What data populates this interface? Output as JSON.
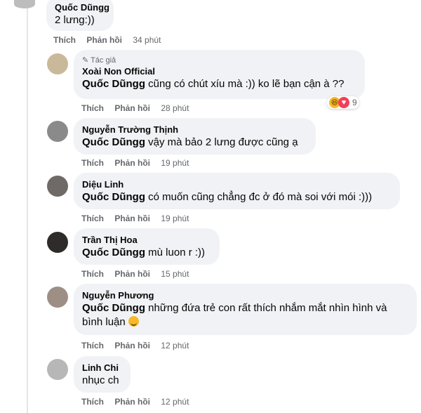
{
  "actions": {
    "like": "Thích",
    "reply": "Phản hồi"
  },
  "author_badge": "Tác giả",
  "top": {
    "name": "Quốc Dũngg",
    "text": "2 lưng:))",
    "time": "34 phút"
  },
  "comments": [
    {
      "name": "Xoài Non Official",
      "mention": "Quốc Dũngg",
      "text": " cũng có chút xíu mà :)) ko lẽ bạn cận à ??",
      "time": "28 phút",
      "reaction_count": "9",
      "reactions": [
        "haha",
        "love"
      ]
    },
    {
      "name": "Nguyễn Trường Thịnh",
      "mention": "Quốc Dũngg",
      "text": " vậy mà bảo 2 lưng được cũng ạ",
      "time": "19 phút"
    },
    {
      "name": "Diệu Linh",
      "mention": "Quốc Dũngg",
      "text": " có muốn cũng chẳng đc ở đó mà soi với mói :)))",
      "time": "19 phút"
    },
    {
      "name": "Trần Thị Hoa",
      "mention": "Quốc Dũngg",
      "text": " mù luon r :))",
      "time": "15 phút"
    },
    {
      "name": "Nguyễn Phương",
      "mention": "Quốc Dũngg",
      "text": " những đứa trẻ con rất thích nhắm mắt nhìn hình và",
      "text2": "bình luận",
      "emoji": "smiling-face-with-hearts",
      "time": "12 phút"
    },
    {
      "name": "Linh Chi",
      "text": "nhục ch",
      "time": "12 phút"
    }
  ],
  "bottom": {
    "time": "12 phút"
  },
  "colors": {
    "bubble": "#f0f2f5",
    "meta": "#65676b",
    "text": "#050505",
    "love": "#f33e58",
    "haha": "#f7b928"
  }
}
